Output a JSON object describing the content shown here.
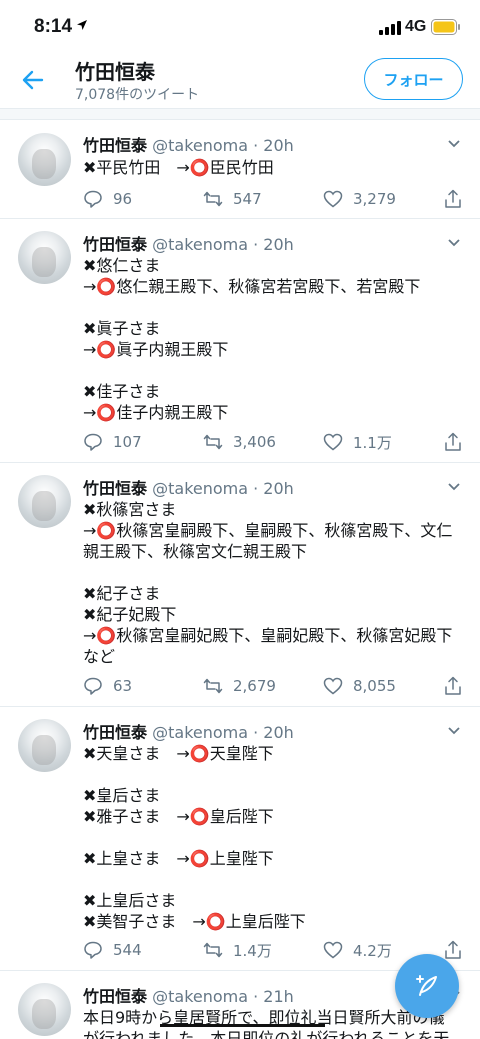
{
  "status_bar": {
    "time": "8:14",
    "network": "4G"
  },
  "header": {
    "title": "竹田恒泰",
    "subtitle": "7,078件のツイート",
    "follow_label": "フォロー"
  },
  "tweets": [
    {
      "name": "竹田恒泰",
      "handle": "@takenoma · 20h",
      "text": "✖平民竹田　→⭕臣民竹田",
      "replies": "96",
      "retweets": "547",
      "likes": "3,279"
    },
    {
      "name": "竹田恒泰",
      "handle": "@takenoma · 20h",
      "text": "✖悠仁さま\n→⭕悠仁親王殿下、秋篠宮若宮殿下、若宮殿下\n\n✖眞子さま\n→⭕眞子内親王殿下\n\n✖佳子さま\n→⭕佳子内親王殿下",
      "replies": "107",
      "retweets": "3,406",
      "likes": "1.1万"
    },
    {
      "name": "竹田恒泰",
      "handle": "@takenoma · 20h",
      "text": "✖秋篠宮さま\n→⭕秋篠宮皇嗣殿下、皇嗣殿下、秋篠宮殿下、文仁親王殿下、秋篠宮文仁親王殿下\n\n✖紀子さま\n✖紀子妃殿下\n→⭕秋篠宮皇嗣妃殿下、皇嗣妃殿下、秋篠宮妃殿下など",
      "replies": "63",
      "retweets": "2,679",
      "likes": "8,055"
    },
    {
      "name": "竹田恒泰",
      "handle": "@takenoma · 20h",
      "text": "✖天皇さま　→⭕天皇陛下\n\n✖皇后さま\n✖雅子さま　→⭕皇后陛下\n\n✖上皇さま　→⭕上皇陛下\n\n✖上皇后さま\n✖美智子さま　→⭕上皇后陛下",
      "replies": "544",
      "retweets": "1.4万",
      "likes": "4.2万"
    },
    {
      "name": "竹田恒泰",
      "handle": "@takenoma · 21h",
      "text": "本日9時から皇居賢所で、即位礼当日賢所大前の儀\nが行われました。本日即位の礼が行われることを天",
      "replies": "",
      "retweets": "",
      "likes": ""
    }
  ],
  "colors": {
    "accent": "#1da1f2",
    "muted": "#657786",
    "fab": "#4aa6ea",
    "divider": "#e6ecf0"
  }
}
